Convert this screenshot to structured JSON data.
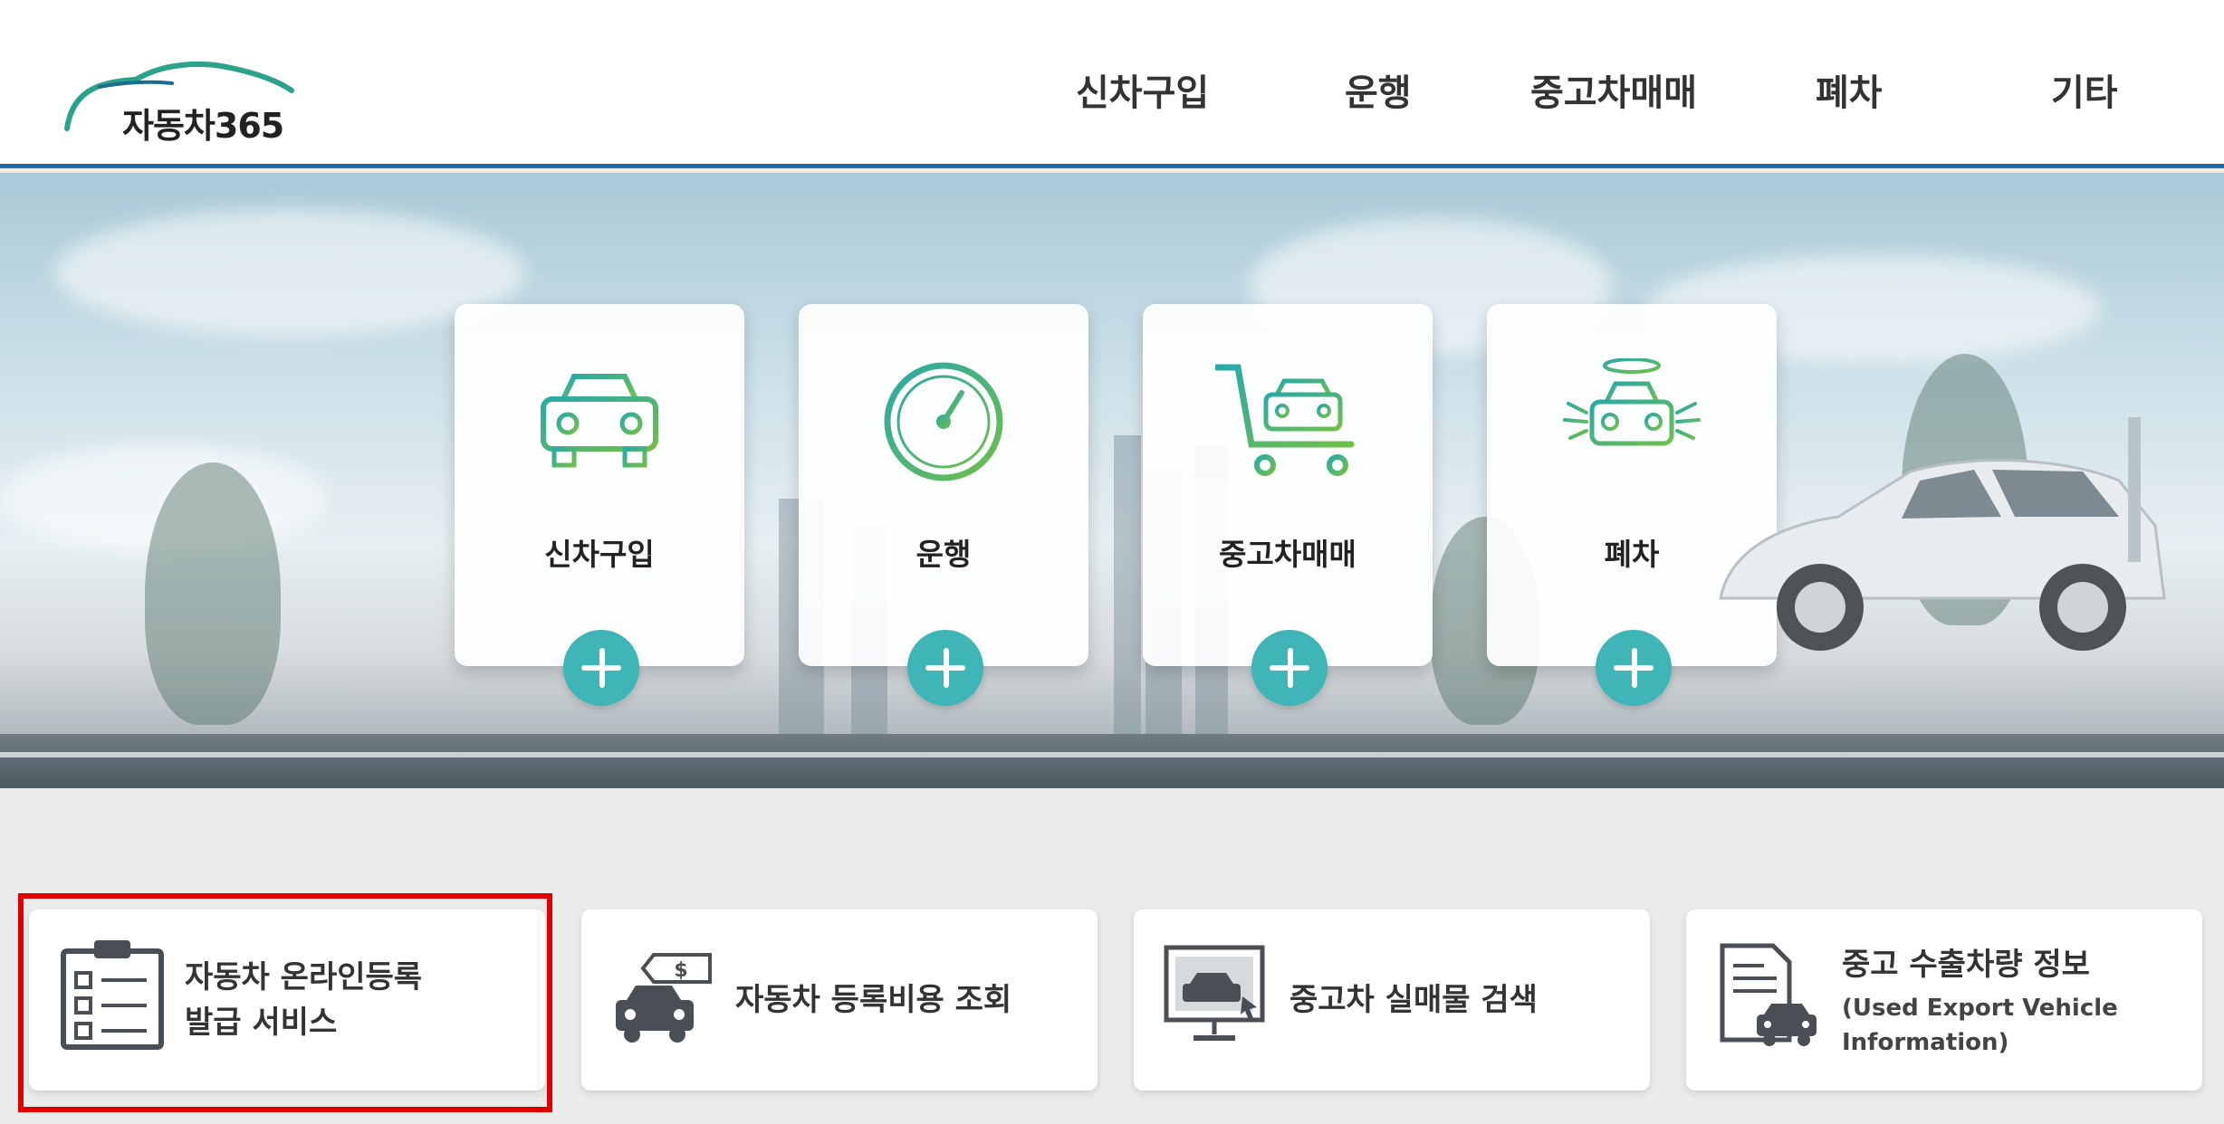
{
  "header": {
    "logo_text": "자동차365",
    "nav": [
      "신차구입",
      "운행",
      "중고차매매",
      "폐차",
      "기타"
    ]
  },
  "hero": {
    "cards": [
      {
        "label": "신차구입",
        "icon": "car-icon"
      },
      {
        "label": "운행",
        "icon": "speedometer-icon"
      },
      {
        "label": "중고차매매",
        "icon": "cart-car-icon"
      },
      {
        "label": "폐차",
        "icon": "angel-car-icon"
      }
    ]
  },
  "services": [
    {
      "title_line1": "자동차 온라인등록",
      "title_line2": "발급 서비스",
      "icon": "checklist-icon"
    },
    {
      "title": "자동차 등록비용 조회",
      "icon": "car-price-tag-icon"
    },
    {
      "title": "중고차 실매물 검색",
      "icon": "monitor-car-icon"
    },
    {
      "title": "중고 수출차량 정보",
      "sub_line1": "(Used Export Vehicle",
      "sub_line2": "Information)",
      "icon": "document-car-icon"
    }
  ],
  "colors": {
    "accent": "#3fb5b8",
    "header_border": "#1f6aa5",
    "highlight": "#e10000"
  }
}
